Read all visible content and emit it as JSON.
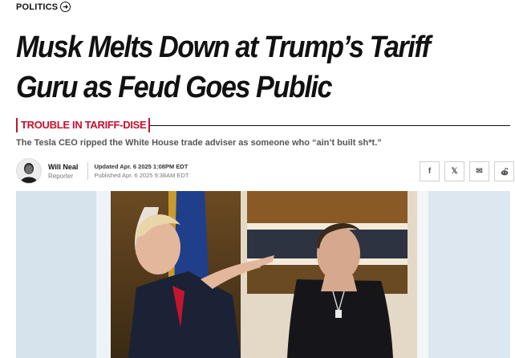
{
  "section": {
    "label": "POLITICS",
    "icon": "arrow-circle-right-icon"
  },
  "headline": "Musk Melts Down at Trump’s Tariff Guru as Feud Goes Public",
  "kicker": "TROUBLE IN TARIFF-DISE",
  "dek": "The Tesla CEO ripped the White House trade adviser as someone who “ain’t built sh*t.”",
  "author": {
    "name": "Will Neal",
    "role": "Reporter"
  },
  "dates": {
    "updated": "Updated Apr. 6 2025 1:08PM EDT",
    "published": "Published Apr. 6 2025 9:38AM EDT"
  },
  "share": {
    "facebook": "f",
    "x": "𝕏",
    "email": "✉",
    "reddit": "reddit-icon"
  },
  "colors": {
    "kicker": "#c8102e",
    "text": "#111111",
    "dek": "#555555"
  }
}
